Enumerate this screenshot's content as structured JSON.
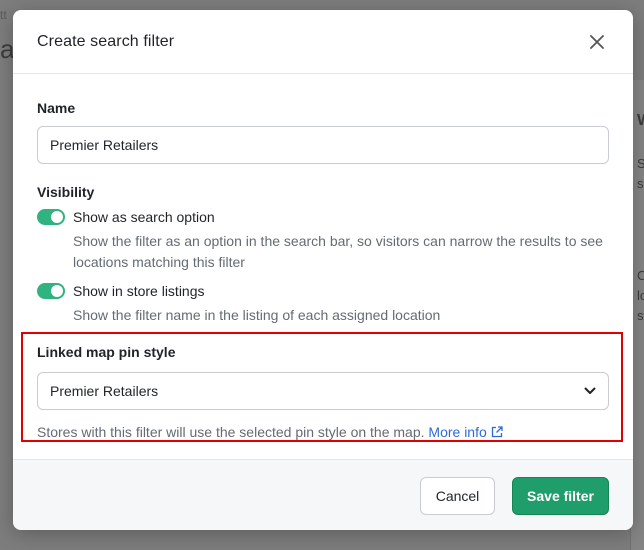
{
  "background": {
    "breadcrumb_fragment": "tt",
    "title_fragment": "a",
    "right_fragment_1": "W",
    "right_fragment_2a": "S",
    "right_fragment_2b": "s",
    "right_fragment_3a": "C",
    "right_fragment_3b": "lo",
    "right_fragment_3c": "st"
  },
  "modal": {
    "title": "Create search filter",
    "close_icon": "close-icon",
    "name_label": "Name",
    "name_value": "Premier Retailers",
    "visibility_label": "Visibility",
    "toggles": [
      {
        "label": "Show as search option",
        "description": "Show the filter as an option in the search bar, so visitors can narrow the results to see locations matching this filter",
        "enabled": true
      },
      {
        "label": "Show in store listings",
        "description": "Show the filter name in the listing of each assigned location",
        "enabled": true
      }
    ],
    "pin_style_label": "Linked map pin style",
    "pin_style_value": "Premier Retailers",
    "pin_style_help": "Stores with this filter will use the selected pin style on the map.",
    "more_info_label": "More info",
    "cancel_label": "Cancel",
    "save_label": "Save filter"
  },
  "colors": {
    "accent": "#1f9d6a",
    "toggle_on": "#2fb380",
    "link": "#2d6ad9",
    "highlight": "#e00000"
  }
}
